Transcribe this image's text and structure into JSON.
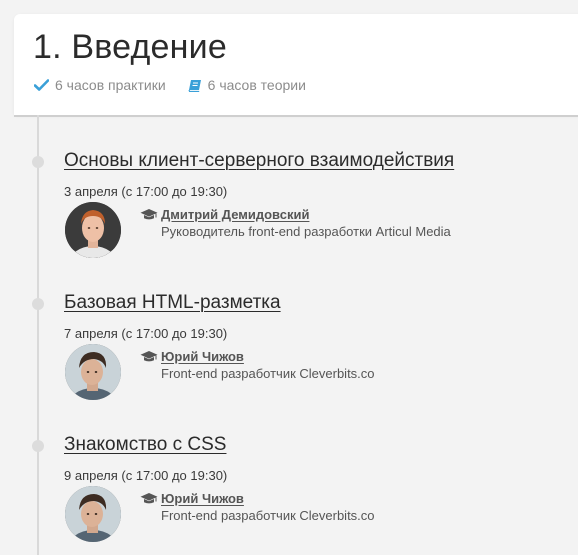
{
  "section": {
    "title": "1. Введение",
    "practice_hours": "6 часов практики",
    "theory_hours": "6 часов теории",
    "colors": {
      "check": "#3aa0d8",
      "book": "#3aa0d8"
    }
  },
  "lessons": [
    {
      "title": "Основы клиент-серверного взаимодействия",
      "date": "3 апреля (с 17:00 до 19:30)",
      "teacher_name": "Дмитрий Демидовский",
      "teacher_role": "Руководитель front-end разработки Articul Media"
    },
    {
      "title": "Базовая HTML-разметка",
      "date": "7 апреля (с 17:00 до 19:30)",
      "teacher_name": "Юрий Чижов",
      "teacher_role": "Front-end разработчик Cleverbits.co"
    },
    {
      "title": "Знакомство с CSS",
      "date": "9 апреля (с 17:00 до 19:30)",
      "teacher_name": "Юрий Чижов",
      "teacher_role": "Front-end разработчик Cleverbits.co"
    }
  ]
}
